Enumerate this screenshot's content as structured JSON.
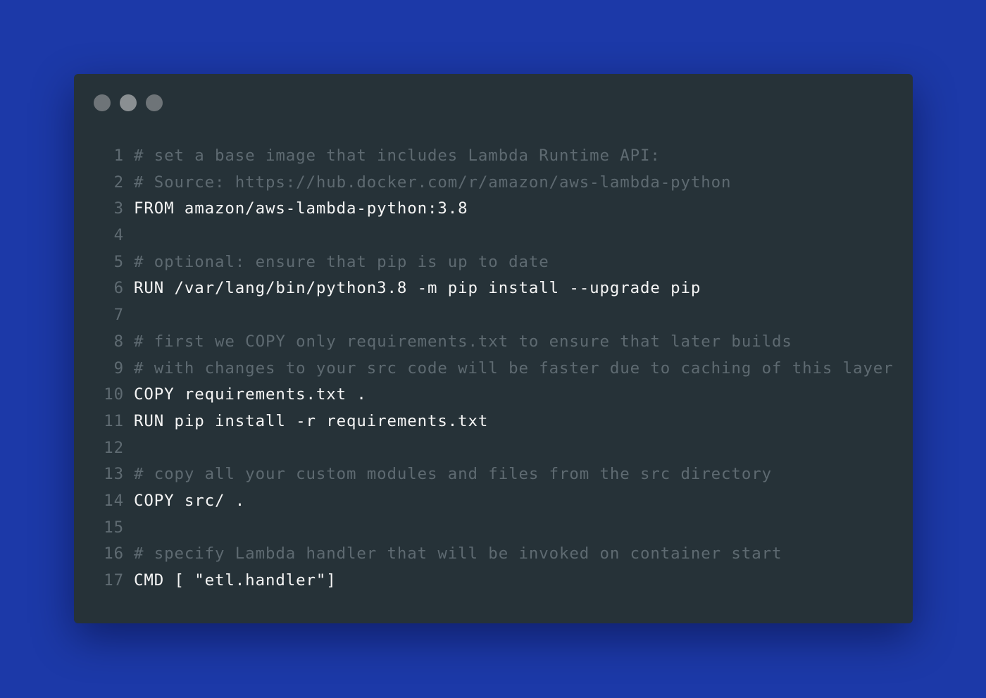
{
  "colors": {
    "background": "#1c39a8",
    "window": "#263238",
    "code_text": "#f5f5f5",
    "comment_text": "#5e6a71",
    "line_number": "#5f6b72"
  },
  "window_controls": [
    "dot",
    "dot",
    "dot"
  ],
  "code": {
    "lines": [
      {
        "number": "1",
        "text": "# set a base image that includes Lambda Runtime API:",
        "comment": true
      },
      {
        "number": "2",
        "text": "# Source: https://hub.docker.com/r/amazon/aws-lambda-python",
        "comment": true
      },
      {
        "number": "3",
        "text": "FROM amazon/aws-lambda-python:3.8",
        "comment": false
      },
      {
        "number": "4",
        "text": "",
        "comment": false
      },
      {
        "number": "5",
        "text": "# optional: ensure that pip is up to date",
        "comment": true
      },
      {
        "number": "6",
        "text": "RUN /var/lang/bin/python3.8 -m pip install --upgrade pip",
        "comment": false
      },
      {
        "number": "7",
        "text": "",
        "comment": false
      },
      {
        "number": "8",
        "text": "# first we COPY only requirements.txt to ensure that later builds",
        "comment": true
      },
      {
        "number": "9",
        "text": "# with changes to your src code will be faster due to caching of this layer",
        "comment": true
      },
      {
        "number": "10",
        "text": "COPY requirements.txt .",
        "comment": false
      },
      {
        "number": "11",
        "text": "RUN pip install -r requirements.txt",
        "comment": false
      },
      {
        "number": "12",
        "text": "",
        "comment": false
      },
      {
        "number": "13",
        "text": "# copy all your custom modules and files from the src directory",
        "comment": true
      },
      {
        "number": "14",
        "text": "COPY src/ .",
        "comment": false
      },
      {
        "number": "15",
        "text": "",
        "comment": false
      },
      {
        "number": "16",
        "text": "# specify Lambda handler that will be invoked on container start",
        "comment": true
      },
      {
        "number": "17",
        "text": "CMD [ \"etl.handler\"]",
        "comment": false
      }
    ]
  }
}
